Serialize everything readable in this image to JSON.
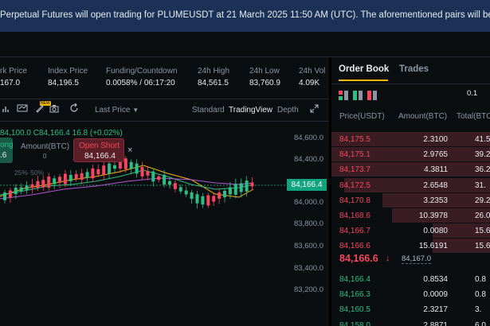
{
  "banner": {
    "text": "Perpetual Futures will open trading for PLUMEUSDT at 21 March 2025 11:50 AM (UTC). The aforementioned pairs will be launched in tandem"
  },
  "ticker": {
    "mark_price": {
      "label": "rk Price",
      "value": "167.0"
    },
    "index_price": {
      "label": "Index Price",
      "value": "84,196.5"
    },
    "funding": {
      "label": "Funding/Countdown",
      "value": "0.0058% / 06:17:20"
    },
    "high": {
      "label": "24h High",
      "value": "84,561.5"
    },
    "low": {
      "label": "24h Low",
      "value": "83,760.9"
    },
    "vol": {
      "label": "24h Vol",
      "value": "4.09K"
    }
  },
  "toolbar": {
    "new_badge": "NEW",
    "last_price": "Last Price",
    "views": [
      "Standard",
      "TradingView",
      "Depth"
    ],
    "active_view": "TradingView"
  },
  "chart": {
    "ohlc_line": "84,100.0  C84,166.4  16.8 (+0.02%)",
    "current_price_tag": "84,166.4",
    "y_axis": [
      "84,600.0",
      "84,400.0",
      "84,000.0",
      "83,800.0",
      "83,600.0",
      "83,400.0",
      "83,200.0"
    ],
    "long_btn": {
      "label": "ong",
      "value": ".6"
    },
    "amount": {
      "label": "Amount(BTC)",
      "value": "0"
    },
    "short_btn": {
      "label": "Open Short",
      "value": "84,166.4"
    },
    "close_icon": "×",
    "pct_labels": [
      "25%",
      "50%"
    ]
  },
  "orderbook": {
    "tabs": [
      "Order Book",
      "Trades"
    ],
    "active_tab": "Order Book",
    "step": "0.1",
    "headers": [
      "Price(USDT)",
      "Amount(BTC)",
      "Total(BTC"
    ],
    "asks": [
      {
        "price": "84,175.5",
        "amount": "2.3100",
        "total": "41.5",
        "depth": 1.0
      },
      {
        "price": "84,175.1",
        "amount": "2.9765",
        "total": "39.2",
        "depth": 1.0
      },
      {
        "price": "84,173.7",
        "amount": "4.3811",
        "total": "36.2",
        "depth": 1.0
      },
      {
        "price": "84,172.5",
        "amount": "2.6548",
        "total": "31.",
        "depth": 0.92
      },
      {
        "price": "84,170.8",
        "amount": "3.2353",
        "total": "29.2",
        "depth": 0.68
      },
      {
        "price": "84,168.6",
        "amount": "10.3978",
        "total": "26.0",
        "depth": 0.62
      },
      {
        "price": "84,166.7",
        "amount": "0.0080",
        "total": "15.6",
        "depth": 0.36
      },
      {
        "price": "84,166.6",
        "amount": "15.6191",
        "total": "15.6",
        "depth": 0.36
      }
    ],
    "mid_price": "84,166.6",
    "mid_arrow": "↓",
    "mark_price": "84,167.0",
    "bids": [
      {
        "price": "84,166.4",
        "amount": "0.8534",
        "total": "0.8"
      },
      {
        "price": "84,166.3",
        "amount": "0.0009",
        "total": "0.8"
      },
      {
        "price": "84,160.5",
        "amount": "2.3217",
        "total": "3."
      },
      {
        "price": "84,158.0",
        "amount": "2.8871",
        "total": "6.0"
      }
    ]
  },
  "colors": {
    "up": "#2ebd85",
    "down": "#f6465d",
    "accent": "#f0b90b",
    "banner": "#1b3256"
  }
}
